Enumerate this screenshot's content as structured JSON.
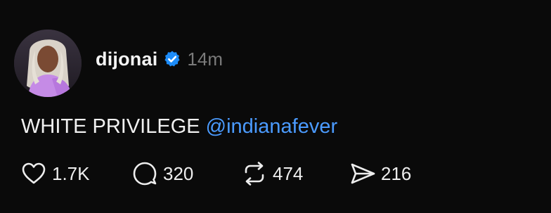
{
  "post": {
    "username": "dijonai",
    "timestamp": "14m",
    "text": "WHITE PRIVILEGE",
    "mention": "@indianafever"
  },
  "actions": {
    "likes": "1.7K",
    "replies": "320",
    "reposts": "474",
    "shares": "216"
  },
  "icons": {
    "like": "heart-icon",
    "reply": "speech-bubble-icon",
    "repost": "repost-arrows-icon",
    "share": "send-icon",
    "verified": "verified-badge-icon"
  },
  "colors": {
    "background": "#0a0a0a",
    "mention": "#4b9bff",
    "verified": "#1d8cf8",
    "timestamp": "#7a7a7a"
  }
}
